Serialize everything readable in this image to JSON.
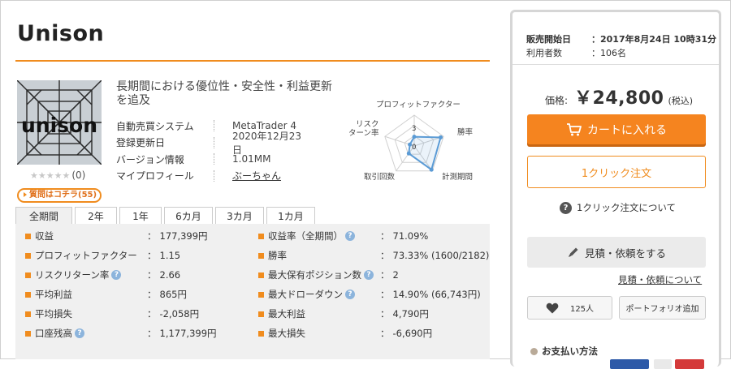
{
  "product": {
    "title": "Unison",
    "image_text": "unison",
    "rating_stars": "★★★★★",
    "rating_count": "(0)",
    "qa_label": "質問はコチラ(55)",
    "description": "長期間における優位性・安全性・利益更新を追及"
  },
  "info": [
    {
      "key": "自動売買システム",
      "value": "MetaTrader 4"
    },
    {
      "key": "登録更新日",
      "value": "2020年12月23日"
    },
    {
      "key": "バージョン情報",
      "value": "1.01MM"
    },
    {
      "key": "マイプロフィール",
      "value": "ぶーちゃん"
    }
  ],
  "radar": {
    "labels": {
      "top": "プロフィットファクター",
      "right": "勝率",
      "bottom_right": "計測期間",
      "bottom_left": "取引回数",
      "left": "リスク\nターン率"
    },
    "tick_max": "3",
    "tick_min": "0",
    "values": [
      0.3,
      0.9,
      0.95,
      0.3,
      0.15
    ]
  },
  "tabs": [
    "全期間",
    "2年",
    "1年",
    "6カ月",
    "3カ月",
    "1カ月"
  ],
  "stats_left": [
    {
      "label": "収益",
      "value": "177,399円",
      "help": false
    },
    {
      "label": "プロフィットファクター",
      "value": "1.15",
      "help": false
    },
    {
      "label": "リスクリターン率",
      "value": "2.66",
      "help": true
    },
    {
      "label": "平均利益",
      "value": "865円",
      "help": false
    },
    {
      "label": "平均損失",
      "value": "-2,058円",
      "help": false
    },
    {
      "label": "口座残高",
      "value": "1,177,399円",
      "help": true
    }
  ],
  "stats_right": [
    {
      "label": "収益率（全期間）",
      "value": "71.09%",
      "help": true
    },
    {
      "label": "勝率",
      "value": "73.33% (1600/2182)",
      "help": false
    },
    {
      "label": "最大保有ポジション数",
      "value": "2",
      "help": true
    },
    {
      "label": "最大ドローダウン",
      "value": "14.90% (66,743円)",
      "help": true
    },
    {
      "label": "最大利益",
      "value": "4,790円",
      "help": false
    },
    {
      "label": "最大損失",
      "value": "-6,690円",
      "help": false
    }
  ],
  "colon": "：",
  "sidebar": {
    "release_key": "販売開始日",
    "release_value": "2017年8月24日 10時31分",
    "users_key": "利用者数",
    "users_value": "106名",
    "price_label": "価格:",
    "price_value": "￥24,800",
    "price_tax": "(税込)",
    "cart_label": "カートに入れる",
    "oneclick_label": "1クリック注文",
    "oneclick_about": "1クリック注文について",
    "quote_label": "見積・依頼をする",
    "quote_about": "見積・依頼について",
    "like_count": "125人",
    "portfolio_label": "ポートフォリオ追加",
    "payment_heading": "お支払い方法"
  },
  "colors": {
    "accent": "#f08c1e",
    "cart": "#f5841f",
    "radar_line": "#5b9bd5",
    "help": "#8cb4dc"
  }
}
